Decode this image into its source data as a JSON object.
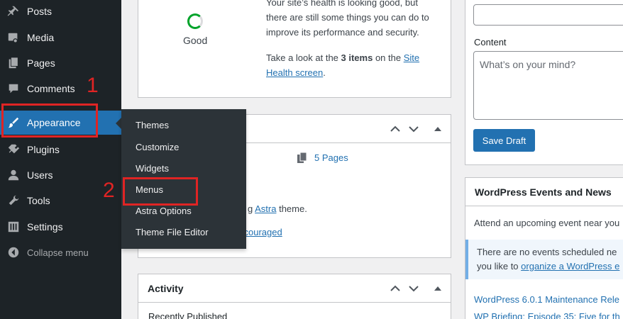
{
  "sidebar": {
    "items": [
      {
        "label": "Posts",
        "icon": "pushpin-icon"
      },
      {
        "label": "Media",
        "icon": "media-icon"
      },
      {
        "label": "Pages",
        "icon": "pages-icon"
      },
      {
        "label": "Comments",
        "icon": "comment-icon"
      },
      {
        "label": "Appearance",
        "icon": "paintbrush-icon",
        "current": true
      },
      {
        "label": "Plugins",
        "icon": "plugin-icon"
      },
      {
        "label": "Users",
        "icon": "user-icon"
      },
      {
        "label": "Tools",
        "icon": "wrench-icon"
      },
      {
        "label": "Settings",
        "icon": "settings-icon"
      },
      {
        "label": "Collapse menu",
        "icon": "collapse-icon"
      }
    ]
  },
  "flyout": {
    "items": [
      "Themes",
      "Customize",
      "Widgets",
      "Menus",
      "Astra Options",
      "Theme File Editor"
    ]
  },
  "annotations": {
    "step1": "1",
    "step2": "2",
    "color": "#e02424"
  },
  "site_health": {
    "status": "Good",
    "line1": "Your site’s health is looking good, but",
    "line2": "there are still some things you can do to",
    "line3": "improve its performance and security.",
    "take_look_prefix": "Take a look at the ",
    "items_count": "3 items",
    "on_the": " on the ",
    "link_part1": "Site",
    "link_part2": "Health screen",
    "period": "."
  },
  "at_a_glance": {
    "pages": "5 Pages",
    "theme_prefix_fragment": "g ",
    "theme_link": "Astra",
    "theme_suffix": " theme.",
    "discouraged_fragment": "scouraged"
  },
  "activity": {
    "title": "Activity",
    "recently_published": "Recently Published"
  },
  "quick_draft": {
    "content_label": "Content",
    "content_placeholder": "What’s on your mind?",
    "save_label": "Save Draft"
  },
  "events": {
    "title": "WordPress Events and News",
    "attend_text": "Attend an upcoming event near you",
    "notice_line1": "There are no events scheduled ne",
    "notice_line2_prefix": "you like to ",
    "notice_line2_link": "organize a WordPress e",
    "news1": "WordPress 6.0.1 Maintenance Rele",
    "news2": "WP Briefing: Episode 35: Five for th"
  },
  "colors": {
    "sidebar_bg": "#1d2327",
    "accent_blue": "#2271b1",
    "health_green": "#00a32a"
  }
}
